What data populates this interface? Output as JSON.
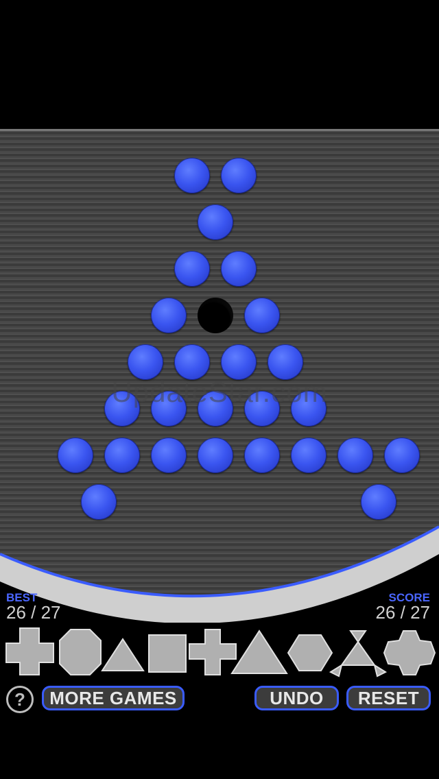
{
  "watermark": "UpdateStar.com",
  "best": {
    "label": "BEST",
    "value": "26 / 27"
  },
  "score": {
    "label": "SCORE",
    "value": "26 / 27"
  },
  "buttons": {
    "help": "?",
    "more_games": "MORE GAMES",
    "undo": "UNDO",
    "reset": "RESET"
  },
  "board": {
    "rows": [
      {
        "cols": [
          4,
          5
        ],
        "empty": []
      },
      {
        "cols": [
          4.5
        ],
        "empty": []
      },
      {
        "cols": [
          4,
          5
        ],
        "empty": []
      },
      {
        "cols": [
          3.5,
          4.5,
          5.5
        ],
        "empty": [
          4.5
        ]
      },
      {
        "cols": [
          3,
          4,
          5,
          6
        ],
        "empty": []
      },
      {
        "cols": [
          2.5,
          3.5,
          4.5,
          5.5,
          6.5
        ],
        "empty": []
      },
      {
        "cols": [
          1.5,
          2.5,
          3.5,
          4.5,
          5.5,
          6.5,
          7.5,
          8.5
        ],
        "empty": []
      },
      {
        "cols": [
          2,
          8
        ],
        "empty": []
      }
    ]
  },
  "shape_selector": [
    {
      "name": "cross-board-icon"
    },
    {
      "name": "octagon-board-icon"
    },
    {
      "name": "small-triangle-board-icon"
    },
    {
      "name": "square-board-icon"
    },
    {
      "name": "plus-board-icon"
    },
    {
      "name": "large-triangle-board-icon"
    },
    {
      "name": "hexagon-board-icon"
    },
    {
      "name": "star-triangle-board-icon"
    },
    {
      "name": "snowflake-board-icon"
    }
  ],
  "colors": {
    "peg": "#3a55f0",
    "accent": "#3a5cff",
    "board": "#3c3c3c",
    "shape": "#b0b0b0"
  }
}
